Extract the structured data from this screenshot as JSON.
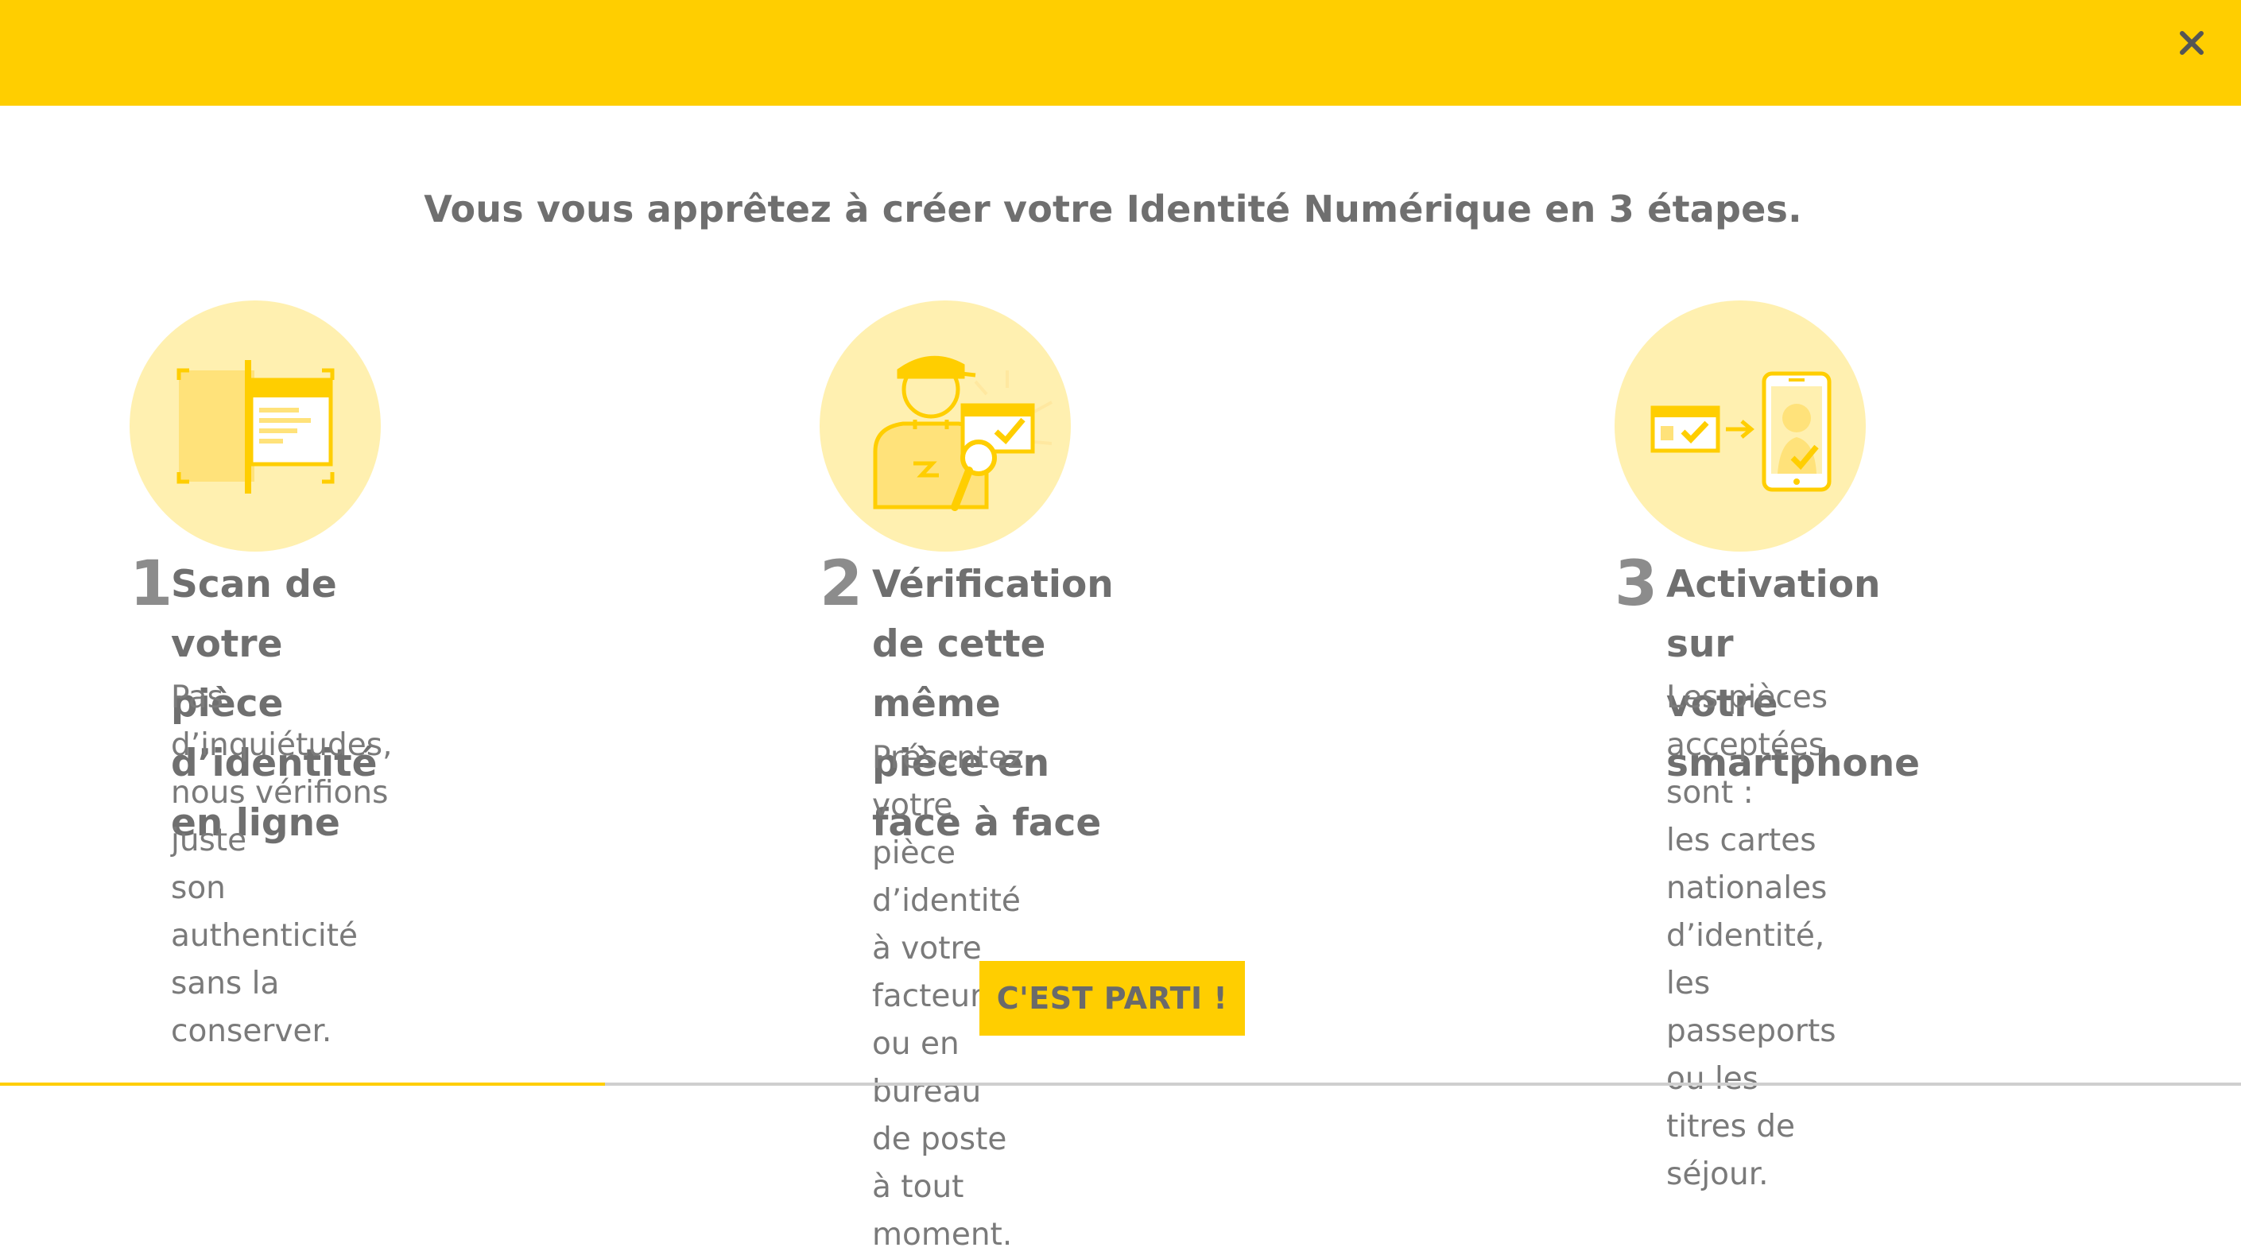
{
  "header": {
    "close_icon": "close-icon"
  },
  "headline": "Vous vous apprêtez à créer votre Identité Numérique en 3 étapes.",
  "steps": [
    {
      "number": "1",
      "title": "Scan de votre pièce\nd’identité en ligne",
      "description": "Pas d’inquiétudes,\nnous vérifions juste\nson authenticité\nsans la conserver.",
      "icon": "scan-document-icon"
    },
    {
      "number": "2",
      "title": "Vérification\nde cette même\npièce en face à face",
      "description": "Présentez votre pièce d’identité\nà votre facteur ou en bureau\nde poste à tout moment.",
      "icon": "postman-verification-icon"
    },
    {
      "number": "3",
      "title": "Activation sur\nvotre smartphone",
      "description": "Les pièces acceptées sont :\nles cartes nationales\nd’identité, les passeports\nou les titres de séjour.",
      "icon": "smartphone-activation-icon"
    }
  ],
  "cta": {
    "label": "C'EST PARTI !"
  },
  "progress": {
    "fraction": 0.27
  },
  "colors": {
    "brand_yellow": "#ffce00",
    "circle_yellow": "#fff0b0",
    "text_gray": "#6f6f6f"
  }
}
